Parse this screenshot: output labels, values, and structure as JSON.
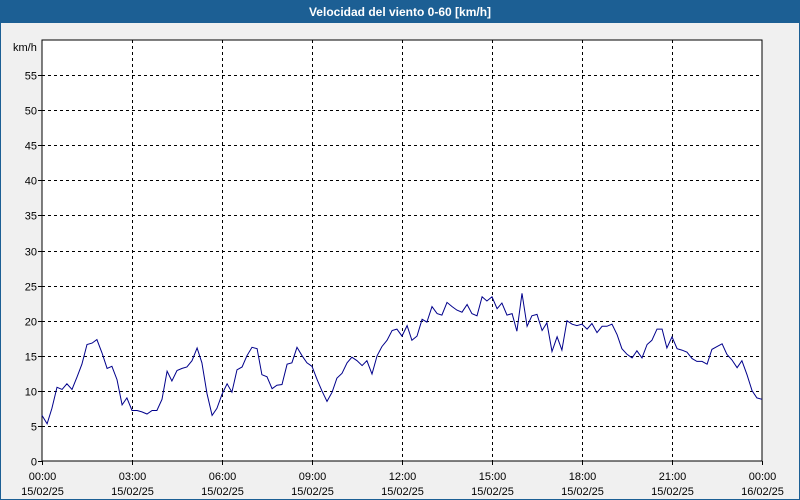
{
  "window": {
    "title": "Velocidad del viento 0-60 [km/h]",
    "title_bar_color": "#1c5f94",
    "background_color": "#f0f0f0",
    "plot_background": "#ffffff"
  },
  "chart_data": {
    "type": "line",
    "title": "Velocidad del viento 0-60 [km/h]",
    "ylabel": "km/h",
    "xlabel": "",
    "ylim": [
      0,
      60
    ],
    "xlim_hours": [
      0,
      24
    ],
    "grid": true,
    "y_ticks": [
      0,
      5,
      10,
      15,
      20,
      25,
      30,
      35,
      40,
      45,
      50,
      55
    ],
    "x_ticks": [
      {
        "time": "00:00",
        "date": "15/02/25"
      },
      {
        "time": "03:00",
        "date": "15/02/25"
      },
      {
        "time": "06:00",
        "date": "15/02/25"
      },
      {
        "time": "09:00",
        "date": "15/02/25"
      },
      {
        "time": "12:00",
        "date": "15/02/25"
      },
      {
        "time": "15:00",
        "date": "15/02/25"
      },
      {
        "time": "18:00",
        "date": "15/02/25"
      },
      {
        "time": "21:00",
        "date": "15/02/25"
      },
      {
        "time": "00:00",
        "date": "16/02/25"
      }
    ],
    "series": [
      {
        "color": "#00008b",
        "points": [
          [
            0.0,
            6.5
          ],
          [
            0.17,
            5.3
          ],
          [
            0.33,
            7.5
          ],
          [
            0.5,
            10.5
          ],
          [
            0.67,
            10.2
          ],
          [
            0.83,
            11.0
          ],
          [
            1.0,
            10.2
          ],
          [
            1.17,
            12.0
          ],
          [
            1.33,
            13.8
          ],
          [
            1.5,
            16.6
          ],
          [
            1.67,
            16.8
          ],
          [
            1.83,
            17.3
          ],
          [
            2.0,
            15.4
          ],
          [
            2.17,
            13.2
          ],
          [
            2.33,
            13.5
          ],
          [
            2.5,
            11.6
          ],
          [
            2.67,
            8.0
          ],
          [
            2.83,
            9.0
          ],
          [
            3.0,
            7.2
          ],
          [
            3.17,
            7.2
          ],
          [
            3.33,
            7.0
          ],
          [
            3.5,
            6.7
          ],
          [
            3.67,
            7.2
          ],
          [
            3.83,
            7.2
          ],
          [
            4.0,
            8.8
          ],
          [
            4.17,
            12.8
          ],
          [
            4.33,
            11.4
          ],
          [
            4.5,
            12.9
          ],
          [
            4.67,
            13.2
          ],
          [
            4.83,
            13.4
          ],
          [
            5.0,
            14.3
          ],
          [
            5.17,
            16.1
          ],
          [
            5.33,
            14.0
          ],
          [
            5.5,
            9.6
          ],
          [
            5.67,
            6.5
          ],
          [
            5.83,
            7.5
          ],
          [
            6.0,
            9.5
          ],
          [
            6.17,
            11.0
          ],
          [
            6.33,
            9.8
          ],
          [
            6.5,
            13.0
          ],
          [
            6.67,
            13.4
          ],
          [
            6.83,
            15.0
          ],
          [
            7.0,
            16.2
          ],
          [
            7.17,
            16.0
          ],
          [
            7.33,
            12.3
          ],
          [
            7.5,
            12.0
          ],
          [
            7.67,
            10.3
          ],
          [
            7.83,
            10.8
          ],
          [
            8.0,
            10.9
          ],
          [
            8.17,
            13.8
          ],
          [
            8.33,
            14.0
          ],
          [
            8.5,
            16.2
          ],
          [
            8.67,
            15.0
          ],
          [
            8.83,
            14.0
          ],
          [
            9.0,
            13.5
          ],
          [
            9.17,
            11.6
          ],
          [
            9.33,
            10.0
          ],
          [
            9.5,
            8.5
          ],
          [
            9.67,
            9.8
          ],
          [
            9.83,
            11.8
          ],
          [
            10.0,
            12.5
          ],
          [
            10.17,
            14.0
          ],
          [
            10.33,
            14.8
          ],
          [
            10.5,
            14.3
          ],
          [
            10.67,
            13.6
          ],
          [
            10.83,
            14.3
          ],
          [
            11.0,
            12.4
          ],
          [
            11.17,
            15.0
          ],
          [
            11.33,
            16.3
          ],
          [
            11.5,
            17.2
          ],
          [
            11.67,
            18.6
          ],
          [
            11.83,
            18.8
          ],
          [
            12.0,
            17.8
          ],
          [
            12.17,
            19.3
          ],
          [
            12.33,
            17.2
          ],
          [
            12.5,
            17.8
          ],
          [
            12.67,
            20.2
          ],
          [
            12.83,
            19.8
          ],
          [
            13.0,
            22.0
          ],
          [
            13.17,
            21.0
          ],
          [
            13.33,
            20.8
          ],
          [
            13.5,
            22.6
          ],
          [
            13.67,
            22.0
          ],
          [
            13.83,
            21.5
          ],
          [
            14.0,
            21.2
          ],
          [
            14.17,
            22.3
          ],
          [
            14.33,
            21.0
          ],
          [
            14.5,
            20.7
          ],
          [
            14.67,
            23.4
          ],
          [
            14.83,
            22.8
          ],
          [
            15.0,
            23.4
          ],
          [
            15.17,
            21.7
          ],
          [
            15.33,
            22.5
          ],
          [
            15.5,
            20.8
          ],
          [
            15.67,
            21.0
          ],
          [
            15.83,
            18.5
          ],
          [
            16.0,
            23.9
          ],
          [
            16.17,
            19.2
          ],
          [
            16.33,
            20.7
          ],
          [
            16.5,
            20.9
          ],
          [
            16.67,
            18.6
          ],
          [
            16.83,
            19.7
          ],
          [
            17.0,
            15.6
          ],
          [
            17.17,
            17.7
          ],
          [
            17.33,
            15.8
          ],
          [
            17.5,
            20.0
          ],
          [
            17.67,
            19.5
          ],
          [
            17.83,
            19.3
          ],
          [
            18.0,
            19.5
          ],
          [
            18.17,
            18.8
          ],
          [
            18.33,
            19.6
          ],
          [
            18.5,
            18.3
          ],
          [
            18.67,
            19.2
          ],
          [
            18.83,
            19.2
          ],
          [
            19.0,
            19.5
          ],
          [
            19.17,
            18.0
          ],
          [
            19.33,
            16.0
          ],
          [
            19.5,
            15.2
          ],
          [
            19.67,
            14.7
          ],
          [
            19.83,
            15.7
          ],
          [
            20.0,
            14.7
          ],
          [
            20.17,
            16.6
          ],
          [
            20.33,
            17.2
          ],
          [
            20.5,
            18.8
          ],
          [
            20.67,
            18.8
          ],
          [
            20.83,
            16.1
          ],
          [
            21.0,
            17.7
          ],
          [
            21.17,
            16.0
          ],
          [
            21.33,
            15.8
          ],
          [
            21.5,
            15.5
          ],
          [
            21.67,
            14.6
          ],
          [
            21.83,
            14.2
          ],
          [
            22.0,
            14.2
          ],
          [
            22.17,
            13.8
          ],
          [
            22.33,
            15.9
          ],
          [
            22.5,
            16.3
          ],
          [
            22.67,
            16.7
          ],
          [
            22.83,
            15.2
          ],
          [
            23.0,
            14.4
          ],
          [
            23.17,
            13.3
          ],
          [
            23.33,
            14.3
          ],
          [
            23.5,
            12.3
          ],
          [
            23.67,
            10.0
          ],
          [
            23.83,
            9.0
          ],
          [
            24.0,
            8.8
          ]
        ]
      }
    ]
  }
}
